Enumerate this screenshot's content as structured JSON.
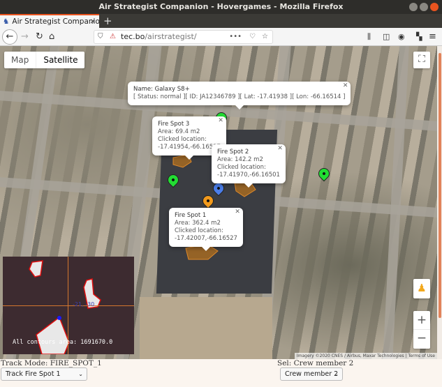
{
  "window": {
    "title": "Air Strategist Companion - Hovergames - Mozilla Firefox"
  },
  "browser": {
    "tab_label": "Air Strategist Companion",
    "url_host": "tec.bo",
    "url_path": "/airstrategist/"
  },
  "map": {
    "type_buttons": [
      "Map",
      "Satellite"
    ],
    "active_type": "Satellite",
    "zoom_in": "+",
    "zoom_out": "−",
    "attribution": "Imagery ©2020 CNES / Airbus, Maxar Technologies",
    "terms": "Terms of Use"
  },
  "popups": {
    "device": {
      "name": "Name: Galaxy S8+",
      "details": "[ Status: normal ][ ID: JA12346789 ][ Lat: -17.41938 ][ Lon: -66.16514 ]"
    },
    "fire3": {
      "title": "Fire Spot 3",
      "area": "Area: 69.4 m2",
      "label": "Clicked location:",
      "coords": "-17.41954,-66.16537"
    },
    "fire2": {
      "title": "Fire Spot 2",
      "area": "Area: 142.2 m2",
      "label": "Clicked location:",
      "coords": "-17.41970,-66.16501"
    },
    "fire1": {
      "title": "Fire Spot 1",
      "area": "Area: 362.4 m2",
      "label": "Clicked location:",
      "coords": "-17.42007,-66.16527"
    }
  },
  "camera": {
    "area_text": "All contours area: 1691670.0",
    "offset_text": "-21, -30"
  },
  "controls": {
    "track_mode": "Track Mode: FIRE_SPOT_1",
    "track_select": "Track Fire Spot 1",
    "sel_label": "Sel: Crew member 2",
    "crew_select": "Crew member 2"
  },
  "colors": {
    "accent": "#e9541f",
    "fire": "#e08a2a",
    "marker_green": "#22dd33",
    "marker_blue": "#4a7de8",
    "marker_orange": "#f29a1c"
  }
}
